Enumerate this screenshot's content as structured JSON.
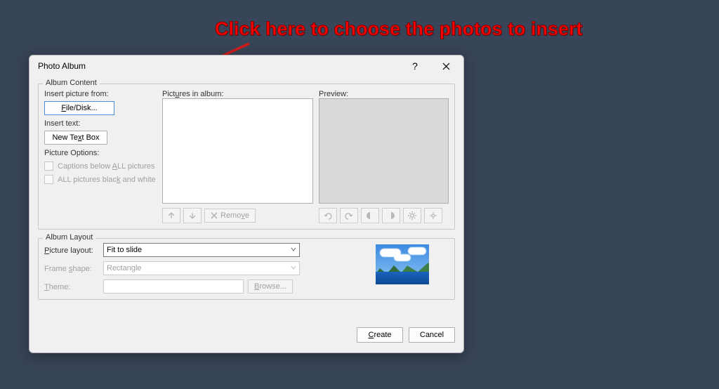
{
  "annotation": {
    "text": "Click here to choose the photos to insert"
  },
  "dialog": {
    "title": "Photo Album",
    "help_symbol": "?",
    "album_content": {
      "legend": "Album Content",
      "insert_picture_from_label": "Insert picture from:",
      "file_disk_btn": "File/Disk...",
      "insert_text_label": "Insert text:",
      "new_text_box_btn": "New Text Box",
      "picture_options_label": "Picture Options:",
      "captions_checkbox": "Captions below ALL pictures",
      "bw_checkbox": "ALL pictures black and white",
      "pictures_in_album_label": "Pictures in album:",
      "preview_label": "Preview:",
      "remove_btn": "Remove"
    },
    "album_layout": {
      "legend": "Album Layout",
      "picture_layout_label": "Picture layout:",
      "picture_layout_value": "Fit to slide",
      "frame_shape_label": "Frame shape:",
      "frame_shape_value": "Rectangle",
      "theme_label": "Theme:",
      "theme_value": "",
      "browse_btn": "Browse..."
    },
    "footer": {
      "create_btn": "Create",
      "cancel_btn": "Cancel"
    }
  }
}
